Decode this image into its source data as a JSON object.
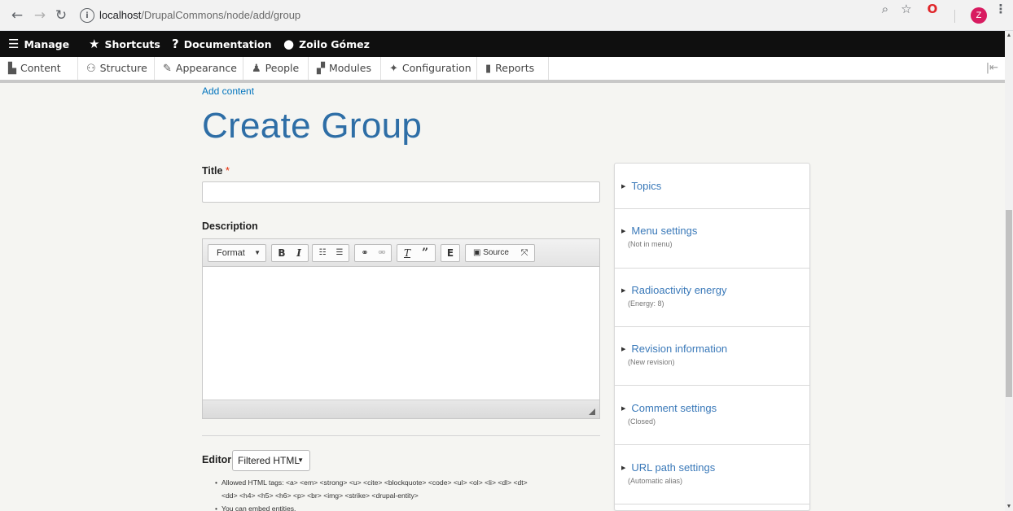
{
  "browser": {
    "url_host": "localhost",
    "url_path": "/DrupalCommons/node/add/group",
    "info_icon": "info-icon",
    "avatar_letter": "Z"
  },
  "toolbar": {
    "manage": "Manage",
    "shortcuts": "Shortcuts",
    "documentation": "Documentation",
    "user": "Zoilo Gómez"
  },
  "tray": {
    "items": [
      {
        "label": "Content",
        "icon": "content-icon"
      },
      {
        "label": "Structure",
        "icon": "structure-icon"
      },
      {
        "label": "Appearance",
        "icon": "appearance-icon"
      },
      {
        "label": "People",
        "icon": "people-icon"
      },
      {
        "label": "Modules",
        "icon": "modules-icon"
      },
      {
        "label": "Configuration",
        "icon": "configuration-icon"
      },
      {
        "label": "Reports",
        "icon": "reports-icon"
      }
    ]
  },
  "page": {
    "breadcrumb": "Add content",
    "title": "Create Group"
  },
  "form": {
    "title_label": "Title",
    "required_marker": "*",
    "title_value": "",
    "description_label": "Description",
    "editor": {
      "format_label": "Format",
      "source_label": "Source"
    },
    "text_format_label": "Editor",
    "text_format_selected": "Filtered HTML",
    "tips": [
      "Allowed HTML tags: <a> <em> <strong> <u> <cite> <blockquote> <code> <ul> <ol> <li> <dl> <dt>",
      "<dd> <h4> <h5> <h6> <p> <br> <img> <strike> <drupal-entity>",
      "You can embed entities."
    ]
  },
  "sidebar": {
    "sections": [
      {
        "title": "Topics",
        "summary": ""
      },
      {
        "title": "Menu settings",
        "summary": "(Not in menu)"
      },
      {
        "title": "Radioactivity energy",
        "summary": "(Energy: 8)"
      },
      {
        "title": "Revision information",
        "summary": "(New revision)"
      },
      {
        "title": "Comment settings",
        "summary": "(Closed)"
      },
      {
        "title": "URL path settings",
        "summary": "(Automatic alias)"
      }
    ]
  },
  "colors": {
    "title": "#2e6ea6",
    "link": "#0074bd",
    "toolbar_bg": "#0f0f0f",
    "required": "#e62600"
  }
}
